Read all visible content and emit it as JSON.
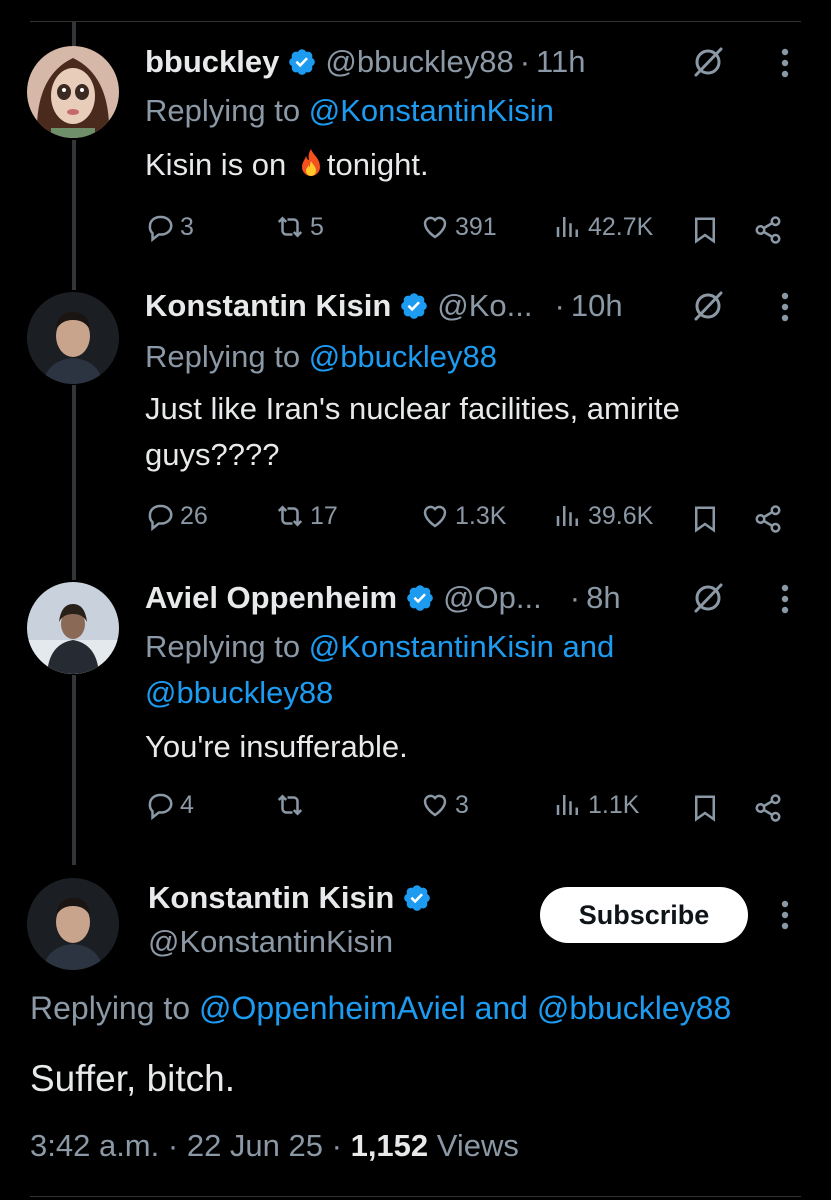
{
  "replies": [
    {
      "name": "bbuckley",
      "handle": "@bbuckley88",
      "dot": "·",
      "time": "11h",
      "replying_prefix": "Replying to",
      "replying_to": "@KonstantinKisin",
      "text_before_emoji": "Kisin is on ",
      "emoji": "fire",
      "text_after_emoji": "tonight.",
      "actions": {
        "replies": "3",
        "reposts": "5",
        "likes": "391",
        "views": "42.7K"
      },
      "avatar_icon": "doll-avatar"
    },
    {
      "name": "Konstantin Kisin",
      "handle": "@Ko...",
      "dot": "·",
      "time": "10h",
      "replying_prefix": "Replying to",
      "replying_to": "@bbuckley88",
      "text": "Just like Iran's nuclear facilities, amirite guys????",
      "actions": {
        "replies": "26",
        "reposts": "17",
        "likes": "1.3K",
        "views": "39.6K"
      },
      "avatar_icon": "man-avatar"
    },
    {
      "name": "Aviel Oppenheim",
      "handle": "@Op...",
      "dot": "·",
      "time": "8h",
      "replying_prefix": "Replying to",
      "replying_to": "@KonstantinKisin and",
      "replying_to_2": "@bbuckley88",
      "text": "You're insufferable.",
      "actions": {
        "replies": "4",
        "reposts": "",
        "likes": "3",
        "views": "1.1K"
      },
      "avatar_icon": "snow-man-avatar"
    }
  ],
  "main_post": {
    "name": "Konstantin Kisin",
    "handle": "@KonstantinKisin",
    "subscribe_label": "Subscribe",
    "replying_prefix": "Replying to",
    "replying_to": "@OppenheimAviel and @bbuckley88",
    "text": "Suffer, bitch.",
    "time": "3:42 a.m.",
    "sep1": "·",
    "date": "22 Jun 25",
    "sep2": "·",
    "views_count": "1,152",
    "views_label": "Views"
  },
  "colors": {
    "background": "#000000",
    "text": "#e7e9ea",
    "muted": "#8b98a5",
    "link": "#1d9bf0",
    "verified": "#1d9bf0"
  }
}
